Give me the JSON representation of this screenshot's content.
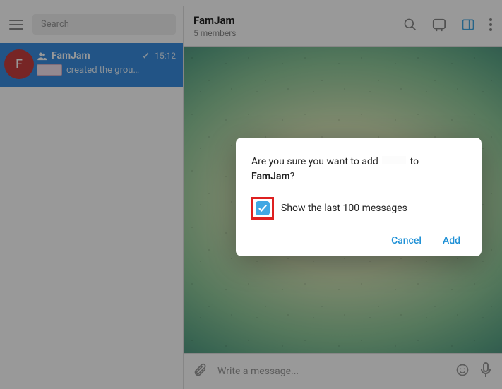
{
  "sidebar": {
    "search_placeholder": "Search",
    "chat": {
      "avatar_letter": "F",
      "name": "FamJam",
      "time": "15:12",
      "preview_suffix": "created the grou…"
    }
  },
  "header": {
    "title": "FamJam",
    "subtitle": "5 members"
  },
  "composer": {
    "placeholder": "Write a message..."
  },
  "dialog": {
    "question_prefix": "Are you sure you want to add ",
    "question_suffix": " to ",
    "group_name": "FamJam",
    "question_end": "?",
    "checkbox_label": "Show the last 100 messages",
    "cancel": "Cancel",
    "add": "Add"
  }
}
